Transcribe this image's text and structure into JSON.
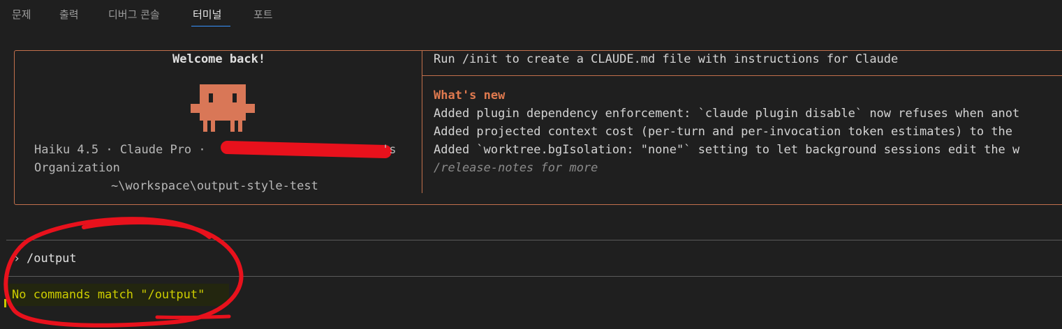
{
  "panel_tabs": [
    {
      "label": "문제"
    },
    {
      "label": "출력"
    },
    {
      "label": "디버그 콘솔"
    },
    {
      "label": "터미널"
    },
    {
      "label": "포트"
    }
  ],
  "active_tab": "터미널",
  "welcome": {
    "title": "Welcome back!",
    "model_line": "Haiku 4.5 · Claude Pro ·",
    "email_tail": "'s",
    "org_line": "Organization",
    "cwd": "~\\workspace\\output-style-test"
  },
  "tips": {
    "init_hint": "Run /init to create a CLAUDE.md file with instructions for Claude",
    "whats_new_title": "What's new",
    "items": [
      "Added plugin dependency enforcement: `claude plugin disable` now refuses when anot",
      "Added projected context cost (per-turn and per-invocation token estimates) to the",
      "Added `worktree.bgIsolation: \"none\"` setting to let background sessions edit the w"
    ],
    "more": "/release-notes for more"
  },
  "prompt": {
    "symbol": "›",
    "input": "/output"
  },
  "status_message": "No commands match \"/output\"",
  "colors": {
    "accent": "#e07a4f",
    "border": "#c2704c",
    "warning": "#cdcd00",
    "annotation": "#e8111c"
  }
}
